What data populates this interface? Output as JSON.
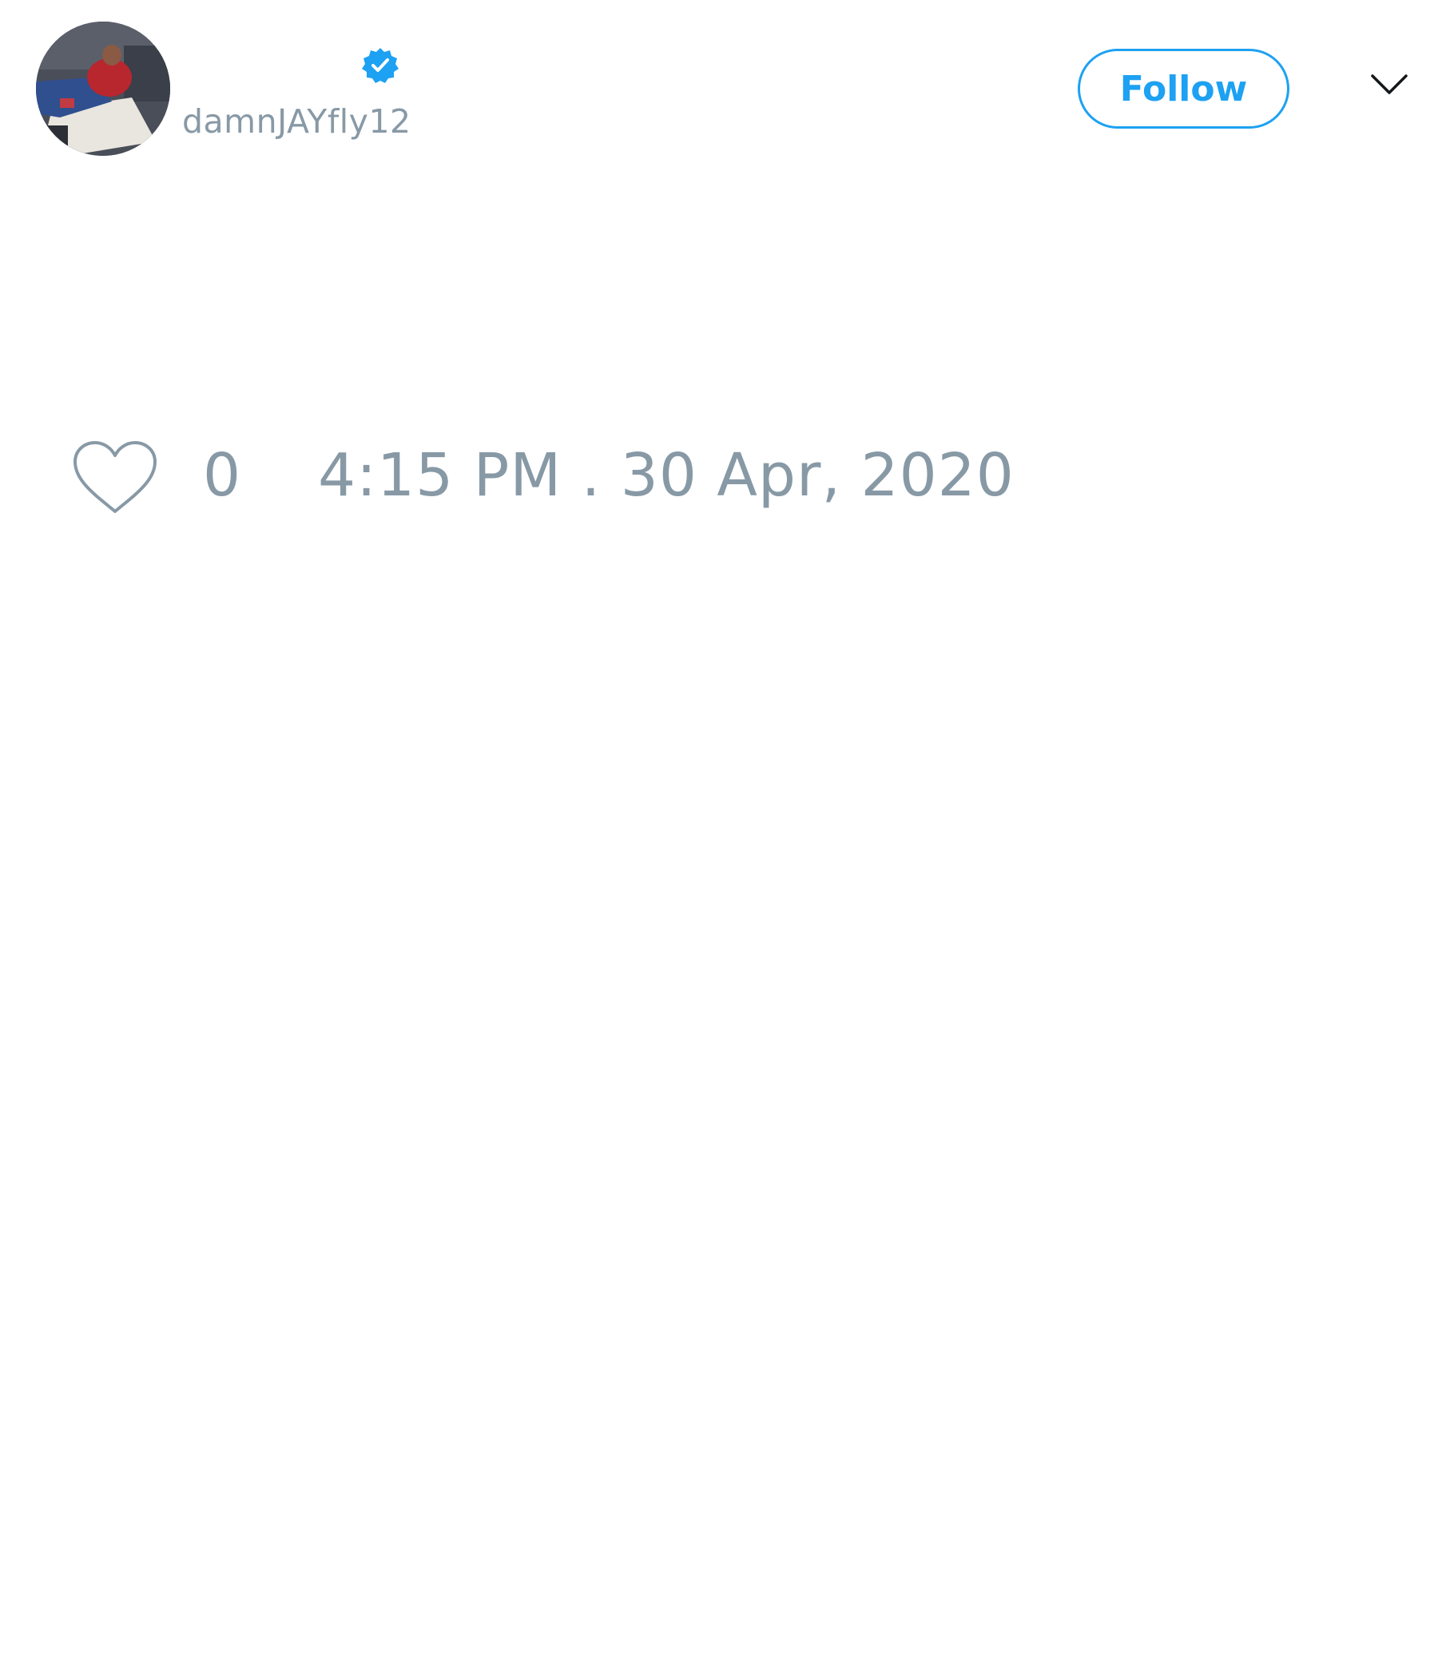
{
  "tweet": {
    "author": {
      "handle": "damnJAYfly12",
      "verified": true,
      "avatar": "profile-photo"
    },
    "follow_label": "Follow",
    "menu_icon": "chevron-down-icon",
    "like_icon": "heart-outline-icon",
    "like_count": "0",
    "timestamp": "4:15 PM . 30 Apr, 2020"
  },
  "colors": {
    "accent": "#1da1f2",
    "muted_text": "#8899a6",
    "background": "#ffffff"
  }
}
